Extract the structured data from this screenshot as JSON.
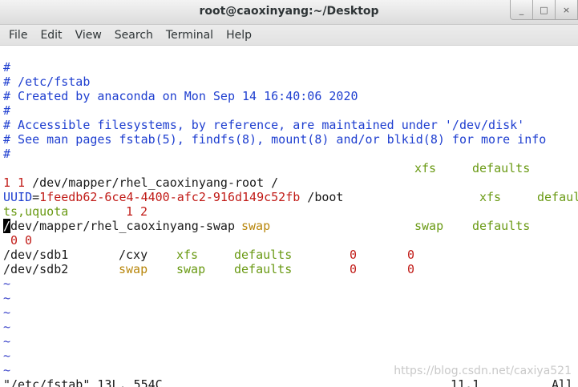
{
  "window": {
    "title": "root@caoxinyang:~/Desktop",
    "buttons": [
      "_",
      "□",
      "×"
    ]
  },
  "menu": [
    "File",
    "Edit",
    "View",
    "Search",
    "Terminal",
    "Help"
  ],
  "terminal": {
    "comments": [
      "#",
      "# /etc/fstab",
      "# Created by anaconda on Mon Sep 14 16:40:06 2020",
      "#",
      "# Accessible filesystems, by reference, are maintained under '/dev/disk'",
      "# See man pages fstab(5), findfs(8), mount(8) and/or blkid(8) for more info",
      "#"
    ],
    "root_entry": {
      "device": "/dev/mapper/rhel_caoxinyang-root /",
      "type": "xfs",
      "options": "defaults",
      "dump_pass": "1 1"
    },
    "boot_entry": {
      "key": "UUID",
      "eq": "=",
      "uuid": "1feedb62-6ce4-4400-afc2-916d149c52fb",
      "mount": " /boot",
      "type": "xfs",
      "options_part1": "defaul",
      "options_part2": "ts,uquota",
      "dump_pass": "1 2"
    },
    "swap_entry": {
      "cursor_char": "/",
      "device_rest": "dev/mapper/rhel_caoxinyang-swap",
      "mount": "swap",
      "type": "swap",
      "options": "defaults",
      "dump_pass": "0 0"
    },
    "sdb1_entry": {
      "device": "/dev/sdb1",
      "mount": "/cxy",
      "type": "xfs",
      "options": "defaults",
      "dump": "0",
      "pass": "0"
    },
    "sdb2_entry": {
      "device": "/dev/sdb2",
      "mount": "swap",
      "type": "swap",
      "options": "defaults",
      "dump": "0",
      "pass": "0"
    },
    "tilde": "~",
    "status": {
      "file": "\"/etc/fstab\" 13L, 554C",
      "position": "11,1",
      "scroll": "All"
    },
    "watermark": "https://blog.csdn.net/caxiya521"
  },
  "colors": {
    "comment": "#1f3fd0",
    "red": "#c11b17",
    "green": "#6a9a14",
    "orange": "#b8860b",
    "tilde": "#3a43c9"
  }
}
